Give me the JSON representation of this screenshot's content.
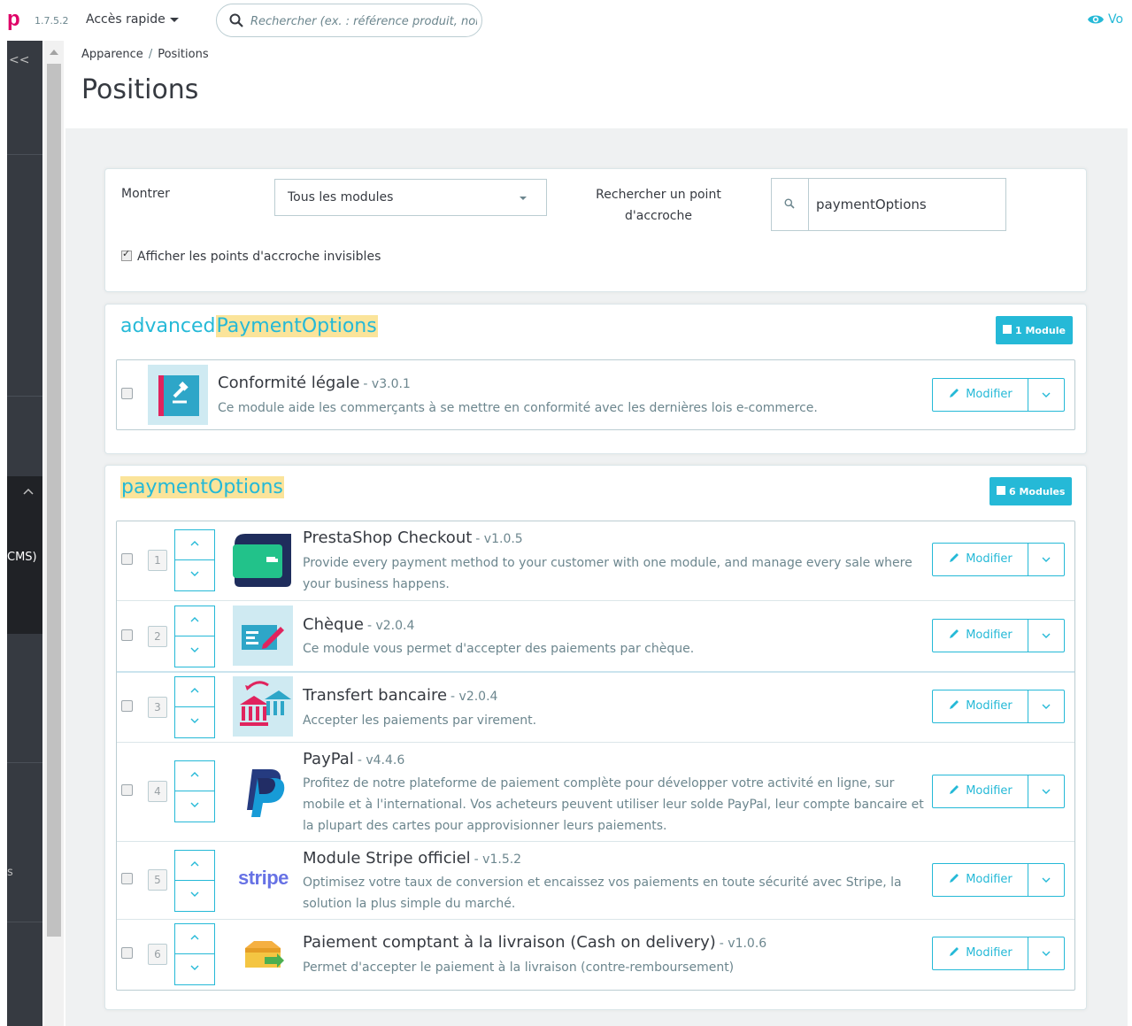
{
  "topbar": {
    "logo": "p",
    "version": "1.7.5.2",
    "quick_access": "Accès rapide",
    "search_placeholder": "Rechercher (ex. : référence produit, nom",
    "view_shop": "Vo"
  },
  "sidebar": {
    "collapse": "<<",
    "fragment_cms": "CMS)",
    "fragment_s": "s"
  },
  "breadcrumb": {
    "parent": "Apparence",
    "separator": "/",
    "current": "Positions"
  },
  "page_title": "Positions",
  "filter": {
    "show_label": "Montrer",
    "show_value": "Tous les modules",
    "search_hook_label": "Rechercher un point d'accroche",
    "search_hook_value": "paymentOptions",
    "invisible_hooks_label": "Afficher les points d'accroche invisibles",
    "invisible_hooks_checked": true
  },
  "hooks": [
    {
      "title_prefix": "advanced",
      "title_highlight": "PaymentOptions",
      "badge": "1 Module",
      "modules": [
        {
          "name": "Conformité légale",
          "version": "- v3.0.1",
          "description": "Ce module aide les commerçants à se mettre en conformité avec les dernières lois e-commerce.",
          "edit_label": "Modifier",
          "icon": "legal-compliance-icon"
        }
      ]
    },
    {
      "title_prefix": "",
      "title_highlight": "paymentOptions",
      "badge": "6 Modules",
      "modules": [
        {
          "position": "1",
          "name": "PrestaShop Checkout",
          "version": "- v1.0.5",
          "description": "Provide every payment method to your customer with one module, and manage every sale where your business happens.",
          "edit_label": "Modifier",
          "icon": "prestashop-checkout-icon"
        },
        {
          "position": "2",
          "name": "Chèque",
          "version": "- v2.0.4",
          "description": "Ce module vous permet d'accepter des paiements par chèque.",
          "edit_label": "Modifier",
          "icon": "cheque-icon"
        },
        {
          "position": "3",
          "name": "Transfert bancaire",
          "version": "- v2.0.4",
          "description": "Accepter les paiements par virement.",
          "edit_label": "Modifier",
          "icon": "bank-transfer-icon"
        },
        {
          "position": "4",
          "name": "PayPal",
          "version": "- v4.4.6",
          "description": "Profitez de notre plateforme de paiement complète pour développer votre activité en ligne, sur mobile et à l'international. Vos acheteurs peuvent utiliser leur solde PayPal, leur compte bancaire et la plupart des cartes pour approvisionner leurs paiements.",
          "edit_label": "Modifier",
          "icon": "paypal-icon"
        },
        {
          "position": "5",
          "name": "Module Stripe officiel",
          "version": "- v1.5.2",
          "description": "Optimisez votre taux de conversion et encaissez vos paiements en toute sécurité avec Stripe, la solution la plus simple du marché.",
          "edit_label": "Modifier",
          "icon": "stripe-icon",
          "logo_text": "stripe"
        },
        {
          "position": "6",
          "name": "Paiement comptant à la livraison (Cash on delivery)",
          "version": "- v1.0.6",
          "description": "Permet d'accepter le paiement à la livraison (contre-remboursement)",
          "edit_label": "Modifier",
          "icon": "cash-on-delivery-icon"
        }
      ]
    }
  ],
  "colors": {
    "accent": "#25b9d7",
    "highlight": "#fbe49a",
    "brand": "#df0067",
    "sidebar": "#363a41"
  }
}
